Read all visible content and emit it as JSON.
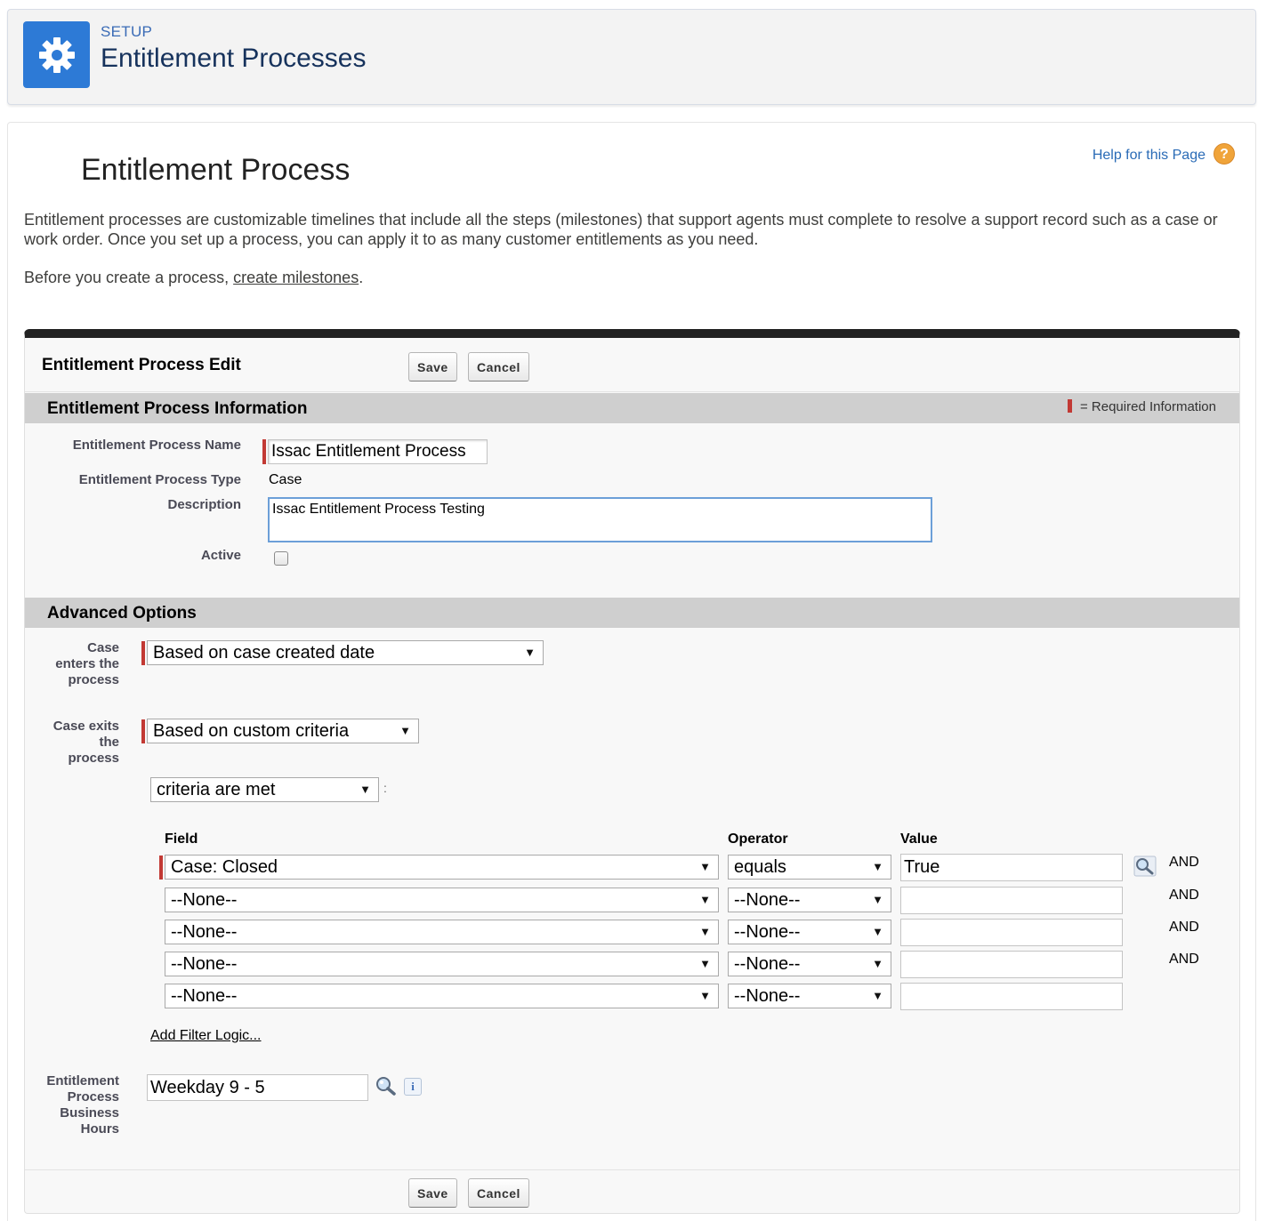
{
  "header": {
    "setup_label": "SETUP",
    "title": "Entitlement Processes"
  },
  "page": {
    "title": "Entitlement Process",
    "help_link": "Help for this Page",
    "help_icon": "?",
    "intro": "Entitlement processes are customizable timelines that include all the steps (milestones) that support agents must complete to resolve a support record such as a case or work order. Once you set up a process, you can apply it to as many customer entitlements as you need.",
    "intro2_prefix": "Before you create a process, ",
    "intro2_link": "create milestones",
    "intro2_suffix": "."
  },
  "form": {
    "title": "Entitlement Process Edit",
    "save_label": "Save",
    "cancel_label": "Cancel",
    "required_legend": "= Required Information"
  },
  "info_section": {
    "title": "Entitlement Process Information",
    "name_label": "Entitlement Process Name",
    "name_value": "Issac Entitlement Process",
    "type_label": "Entitlement Process Type",
    "type_value": "Case",
    "description_label": "Description",
    "description_value": "Issac Entitlement Process Testing",
    "active_label": "Active",
    "active_checked": false
  },
  "advanced": {
    "title": "Advanced Options",
    "enters_label_lines": [
      "Case",
      "enters the",
      "process"
    ],
    "enters_value": "Based on case created date",
    "exits_label_lines": [
      "Case exits",
      "the",
      "process"
    ],
    "exits_value": "Based on custom criteria",
    "criteria_value": "criteria are met",
    "columns": {
      "field": "Field",
      "operator": "Operator",
      "value": "Value"
    },
    "rows": [
      {
        "field": "Case: Closed",
        "operator": "equals",
        "value": "True",
        "connector": "AND"
      },
      {
        "field": "--None--",
        "operator": "--None--",
        "value": "",
        "connector": "AND"
      },
      {
        "field": "--None--",
        "operator": "--None--",
        "value": "",
        "connector": "AND"
      },
      {
        "field": "--None--",
        "operator": "--None--",
        "value": "",
        "connector": "AND"
      },
      {
        "field": "--None--",
        "operator": "--None--",
        "value": "",
        "connector": ""
      }
    ],
    "add_filter_logic": "Add Filter Logic...",
    "business_hours_label_lines": [
      "Entitlement",
      "Process",
      "Business",
      "Hours"
    ],
    "business_hours_value": "Weekday 9 - 5",
    "info_icon_glyph": "i"
  },
  "colors": {
    "brand_blue": "#2d7ad6",
    "required_red": "#c23934",
    "section_gray": "#cfcfcf",
    "help_orange": "#f0a43a"
  }
}
